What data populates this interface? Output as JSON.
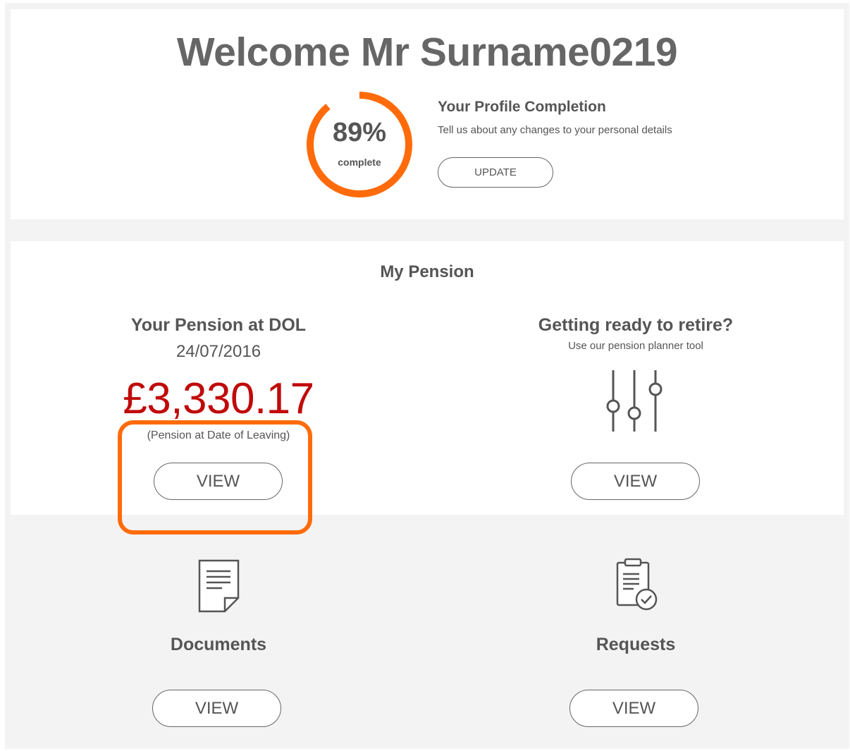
{
  "welcome": {
    "title": "Welcome Mr Surname0219"
  },
  "profile": {
    "percent_label": "89%",
    "percent_value": 0.89,
    "complete_label": "complete",
    "heading": "Your Profile Completion",
    "subtext": "Tell us about any changes to your personal details",
    "update_label": "UPDATE",
    "ring_color": "#ff6b0a"
  },
  "pension": {
    "section_title": "My Pension",
    "dol": {
      "heading": "Your Pension at DOL",
      "date": "24/07/2016",
      "amount": "£3,330.17",
      "amount_color": "#c00a0a",
      "note": "(Pension at Date of Leaving)",
      "view_label": "VIEW"
    },
    "retire": {
      "heading": "Getting ready to retire?",
      "subtext": "Use our pension planner tool",
      "icon": "sliders-icon",
      "view_label": "VIEW"
    }
  },
  "documents": {
    "icon": "document-icon",
    "title": "Documents",
    "view_label": "VIEW"
  },
  "requests": {
    "icon": "clipboard-check-icon",
    "title": "Requests",
    "view_label": "VIEW"
  },
  "highlight_color": "#ff6b0a"
}
